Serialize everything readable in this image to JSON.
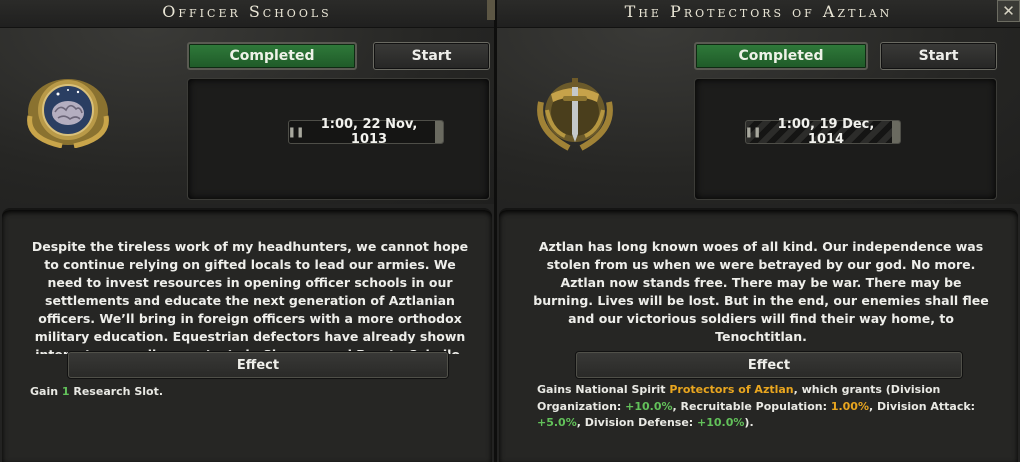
{
  "left": {
    "title": "Officer Schools",
    "status_label": "Completed",
    "start_label": "Start",
    "date": "1:00, 22 Nov, 1013",
    "icon": "brain-laurel-badge-icon",
    "description": "Despite the tireless work of my headhunters, we cannot hope to continue relying on gifted locals to lead our armies. We need to invest resources in opening officer schools in our settlements and educate the next generation of Aztlanian officers. We’ll bring in foreign officers with a more orthodox military education. Equestrian defectors have already shown interests, as well as contacts in Siempre and Puerto Caballo.",
    "effect_label": "Effect",
    "effect": {
      "prefix": "Gain ",
      "value": "1",
      "suffix": " Research Slot."
    }
  },
  "right": {
    "title": "The Protectors of Aztlan",
    "status_label": "Completed",
    "start_label": "Start",
    "date": "1:00, 19 Dec, 1014",
    "icon": "sword-laurel-shield-icon",
    "description": "Aztlan has long known woes of all kind. Our independence was stolen from us when we were betrayed by our god. No more. Aztlan now stands free. There may be war. There may be burning. Lives will be lost. But in the end, our enemies shall flee and our victorious soldiers will find their way home, to Tenochtitlan.",
    "effect_label": "Effect",
    "effect": {
      "t1": "Gains National Spirit ",
      "spirit": "Protectors of Aztlan",
      "t2": ", which grants (Division Organization: ",
      "v1": "+10.0%",
      "t3": ", Recruitable Population: ",
      "v2": "1.00%",
      "t4": ", Division Attack: ",
      "v3": "+5.0%",
      "t5": ", Division Defense: ",
      "v4": "+10.0%",
      "t6": ")."
    }
  },
  "close_label": "✕",
  "colors": {
    "completed_green": "#2f7a3a",
    "positive": "#62c15a",
    "highlight_gold": "#e9a61f"
  }
}
